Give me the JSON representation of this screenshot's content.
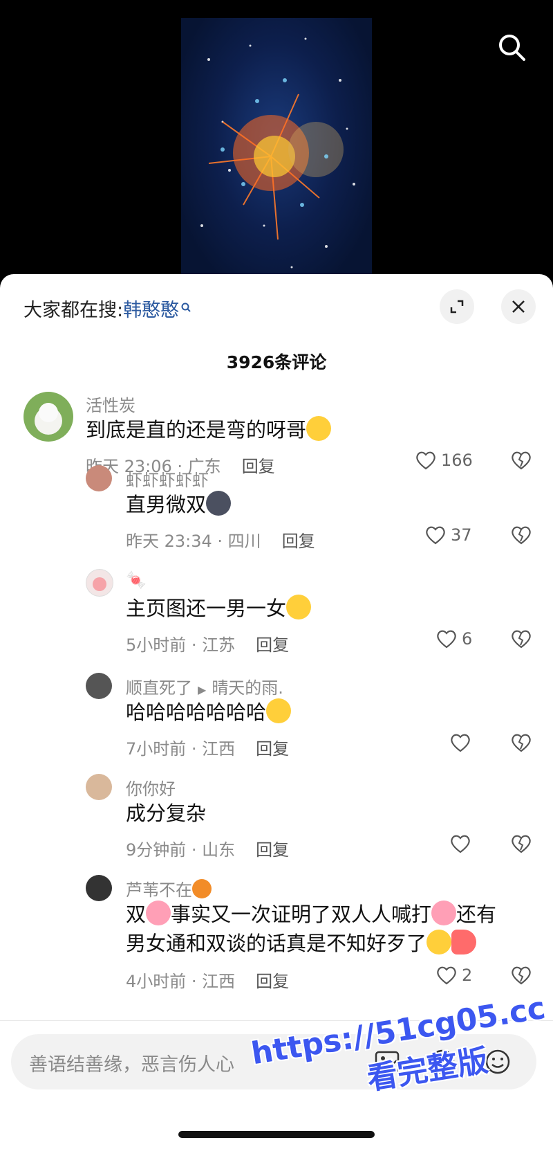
{
  "header": {
    "trending_prefix": "大家都在搜:",
    "trending_keyword": "韩憨憨",
    "comment_count": "3926条评论"
  },
  "comments": [
    {
      "name": "活性炭",
      "text": "到底是直的还是弯的呀哥",
      "time": "昨天 23:06 · 广东",
      "reply": "回复",
      "likes": "166"
    },
    {
      "name": "虾虾虾虾虾",
      "text": "直男微双",
      "time": "昨天 23:34 · 四川",
      "reply": "回复",
      "likes": "37"
    },
    {
      "name": "🍬",
      "text": "主页图还一男一女",
      "time": "5小时前 · 江苏",
      "reply": "回复",
      "likes": "6"
    },
    {
      "name": "顺直死了",
      "reply_to": "晴天的雨.",
      "text": "哈哈哈哈哈哈哈",
      "time": "7小时前 · 江西",
      "reply": "回复",
      "likes": ""
    },
    {
      "name": "你你好",
      "text": "成分复杂",
      "time": "9分钟前 · 山东",
      "reply": "回复",
      "likes": ""
    },
    {
      "name": "芦苇不在",
      "text_line1_a": "双",
      "text_line1_b": "事实又一次证明了双人人喊打",
      "text_line1_c": "还有",
      "text_line2": "男女通和双谈的话真是不知好歹了",
      "time": "4小时前 · 江西",
      "reply": "回复",
      "likes": "2"
    }
  ],
  "input": {
    "placeholder": "善语结善缘，恶言伤人心"
  },
  "watermark": {
    "line1": "https://51cg05.cc",
    "line2": "看完整版"
  },
  "colors": {
    "accent_link": "#2c5aa0",
    "watermark": "#3c57f0",
    "muted": "#8a8a8a"
  },
  "icons": [
    "search-icon",
    "expand-icon",
    "close-icon",
    "heart-icon",
    "broken-heart-icon",
    "image-icon",
    "at-icon",
    "emoji-icon"
  ]
}
